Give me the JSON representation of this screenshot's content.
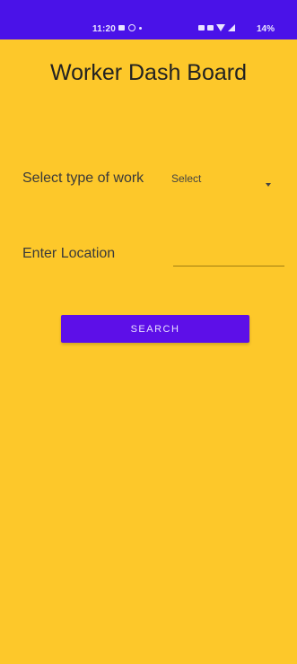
{
  "status_bar": {
    "time": "11:20",
    "battery": "14%",
    "color": "#4a12e8"
  },
  "colors": {
    "background": "#fdc82a",
    "button": "#5d0fe8"
  },
  "page": {
    "title": "Worker Dash Board"
  },
  "form": {
    "work_type_label": "Select type of work",
    "work_type_value": "Select",
    "location_label": "Enter Location",
    "location_value": "",
    "search_label": "SEARCH"
  }
}
